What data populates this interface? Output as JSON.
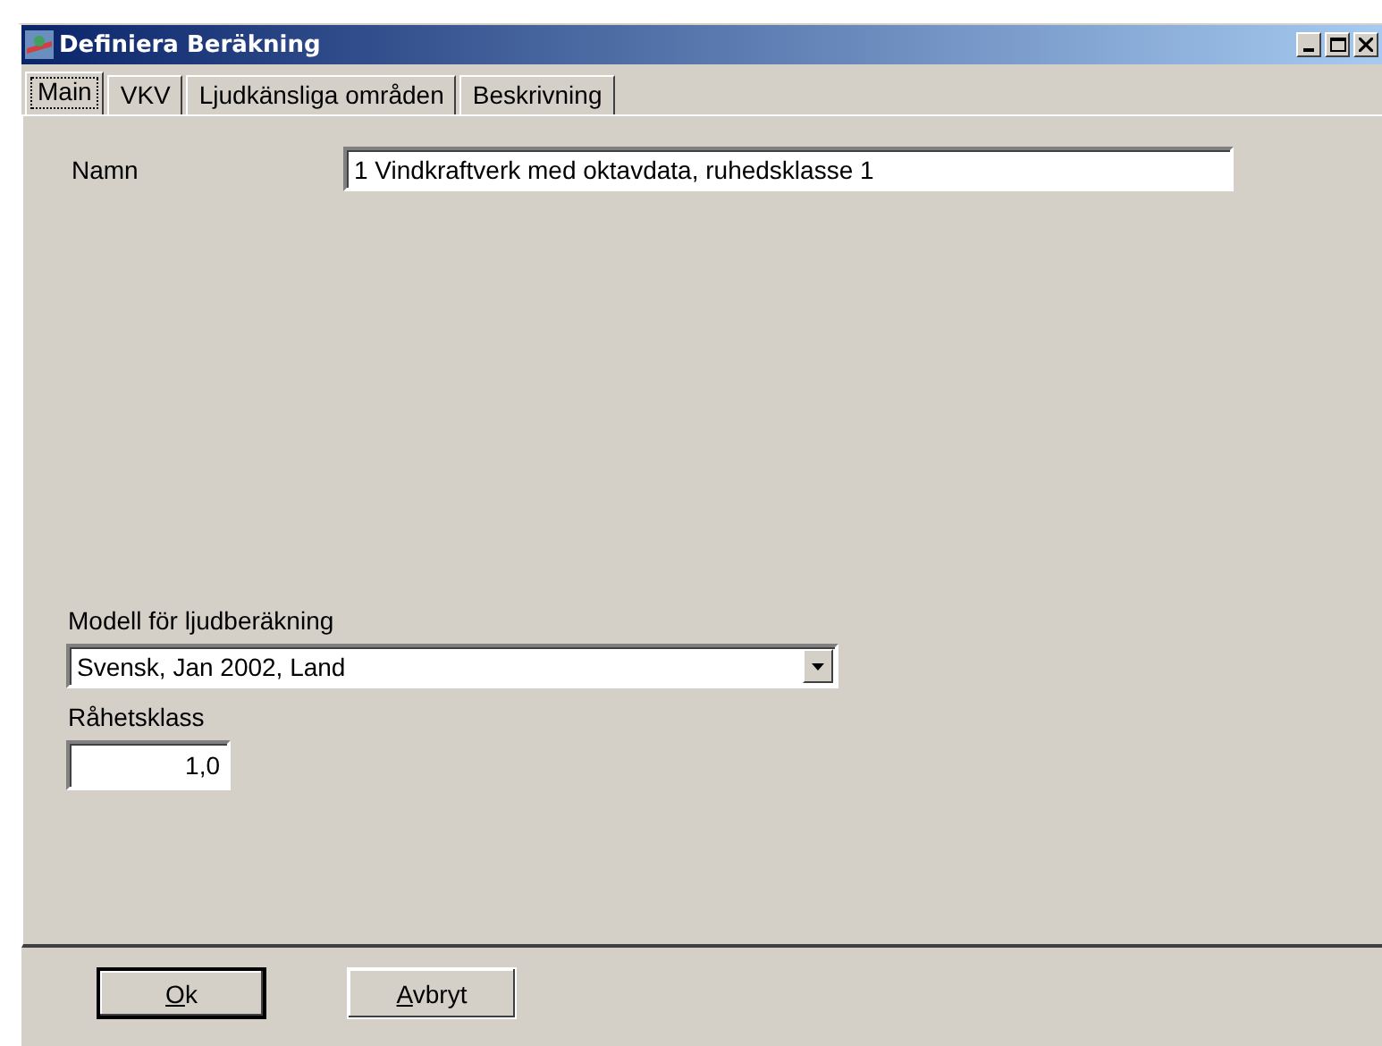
{
  "window": {
    "title": "Definiera Beräkning"
  },
  "tabs": [
    {
      "label": "Main",
      "selected": true
    },
    {
      "label": "VKV",
      "selected": false
    },
    {
      "label": "Ljudkänsliga områden",
      "selected": false
    },
    {
      "label": "Beskrivning",
      "selected": false
    }
  ],
  "name_field": {
    "label": "Namn",
    "value": "1 Vindkraftverk med oktavdata, ruhedsklasse 1"
  },
  "model": {
    "label": "Modell för ljudberäkning",
    "value": "Svensk, Jan 2002, Land"
  },
  "roughness": {
    "label": "Råhetsklass",
    "value": "1,0"
  },
  "buttons": [
    "Ok",
    "Avbryt"
  ]
}
